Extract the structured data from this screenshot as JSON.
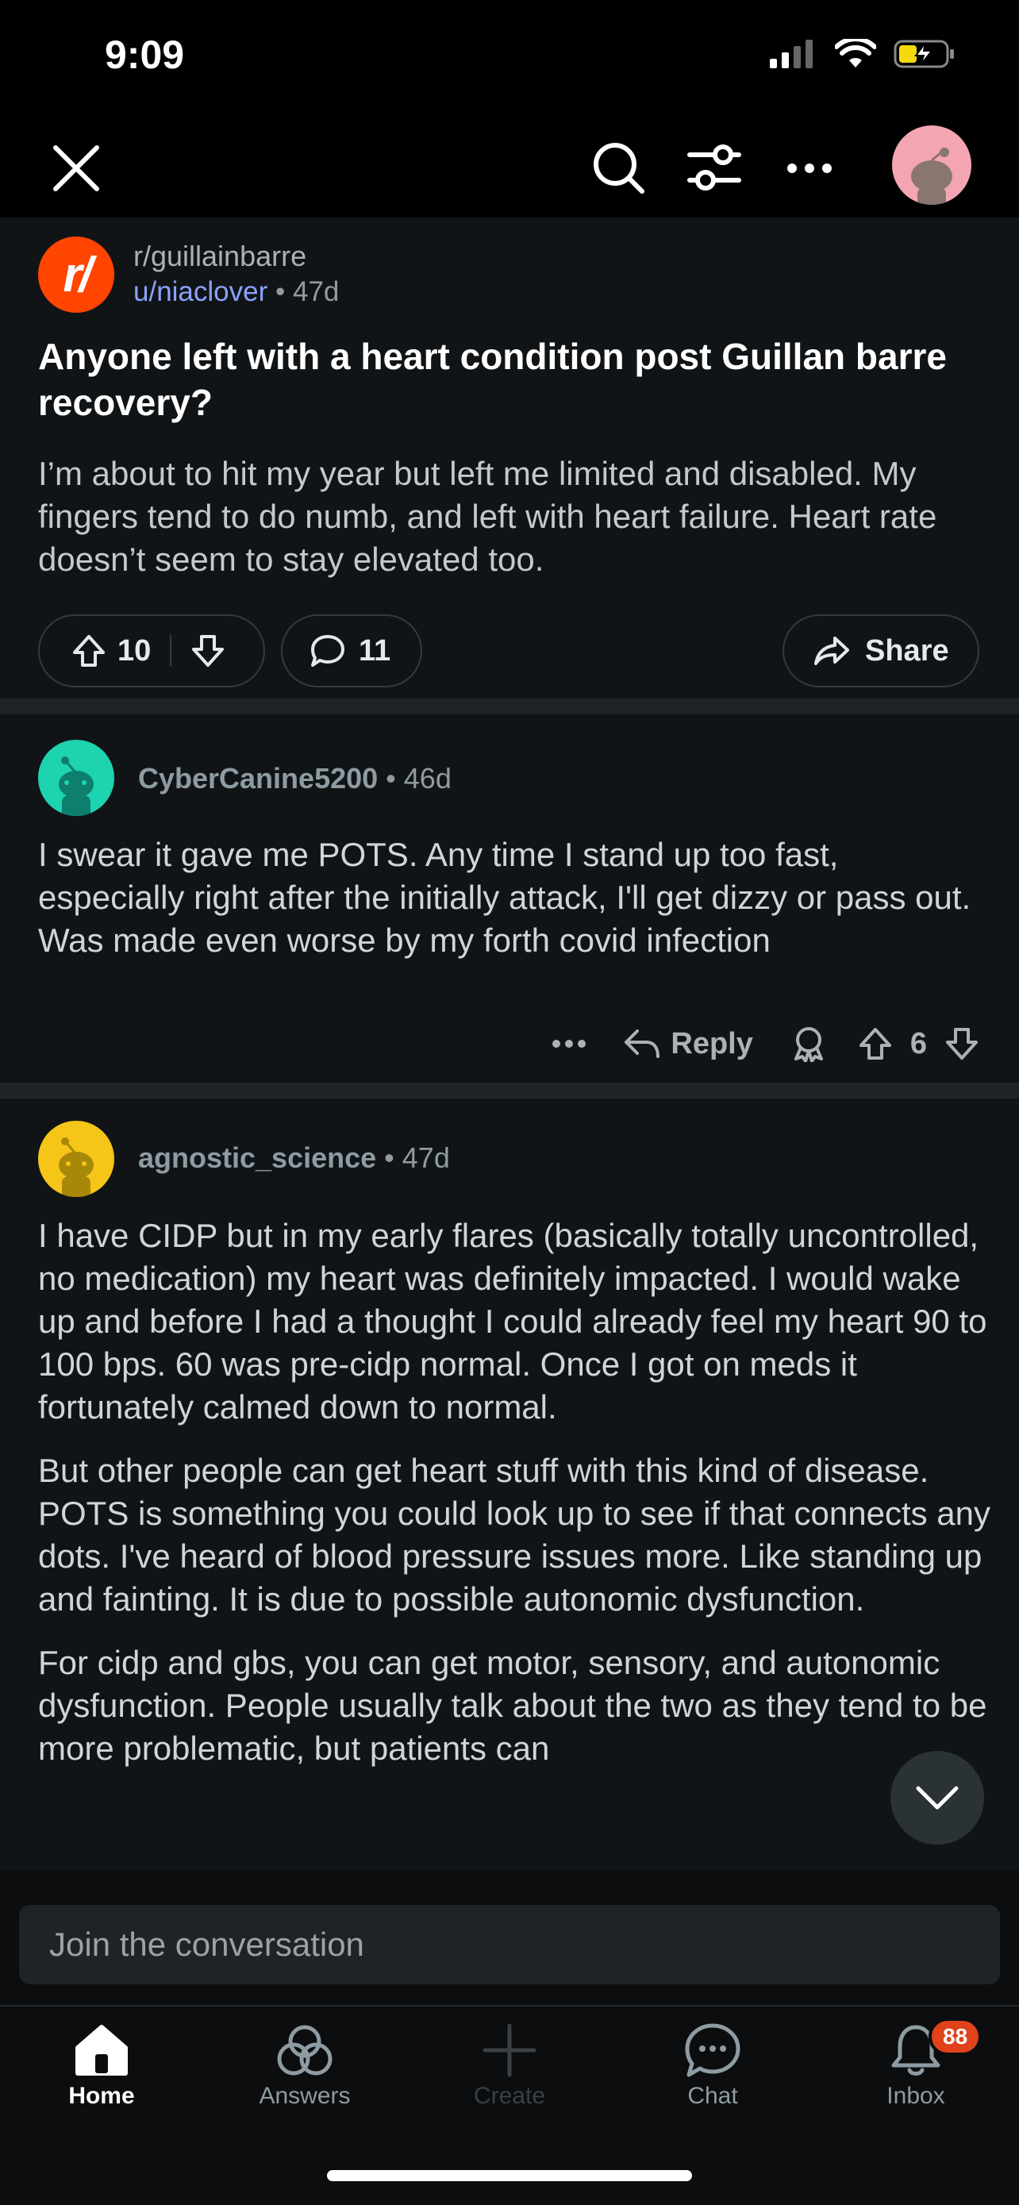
{
  "status_bar": {
    "time": "9:09"
  },
  "post": {
    "subreddit": "r/guillainbarre",
    "author": "u/niaclover",
    "age": "47d",
    "title": "Anyone left with a heart condition post Guillan barre recovery?",
    "body": "I’m about to hit my year but left me limited and disabled. My fingers tend to do numb, and left with heart failure. Heart rate doesn’t seem to stay elevated too.",
    "upvotes": "10",
    "comments": "11",
    "share_label": "Share"
  },
  "comments": [
    {
      "author": "CyberCanine5200",
      "age": "46d",
      "avatar_color": "#1dd3b0",
      "paragraphs": [
        "I swear it gave me POTS. Any time I stand up too fast, especially right after the initially attack, I'll get dizzy or pass out. Was made even worse by my forth covid infection"
      ],
      "reply_label": "Reply",
      "score": "6"
    },
    {
      "author": "agnostic_science",
      "age": "47d",
      "avatar_color": "#f5c518",
      "paragraphs": [
        "I have CIDP but in my early flares (basically totally uncontrolled, no medication) my heart was definitely impacted. I would wake up and before I had a thought I could already feel my heart 90 to 100 bps. 60 was pre-cidp normal. Once I got on meds it fortunately calmed down to normal.",
        "But other people can get heart stuff with this kind of disease. POTS is something you could look up to see if that connects any dots. I've heard of blood pressure issues more. Like standing up and fainting. It is due to possible autonomic dysfunction.",
        "For cidp and gbs, you can get motor, sensory, and autonomic dysfunction. People usually talk about the two as they tend to be more problematic, but patients can"
      ]
    }
  ],
  "composer": {
    "placeholder": "Join the conversation"
  },
  "nav": {
    "home": "Home",
    "answers": "Answers",
    "create": "Create",
    "chat": "Chat",
    "inbox": "Inbox",
    "inbox_badge": "88"
  },
  "colors": {
    "accent_orange": "#ff4500",
    "link_blue": "#8ba2ff",
    "badge_red": "#e0421b"
  }
}
